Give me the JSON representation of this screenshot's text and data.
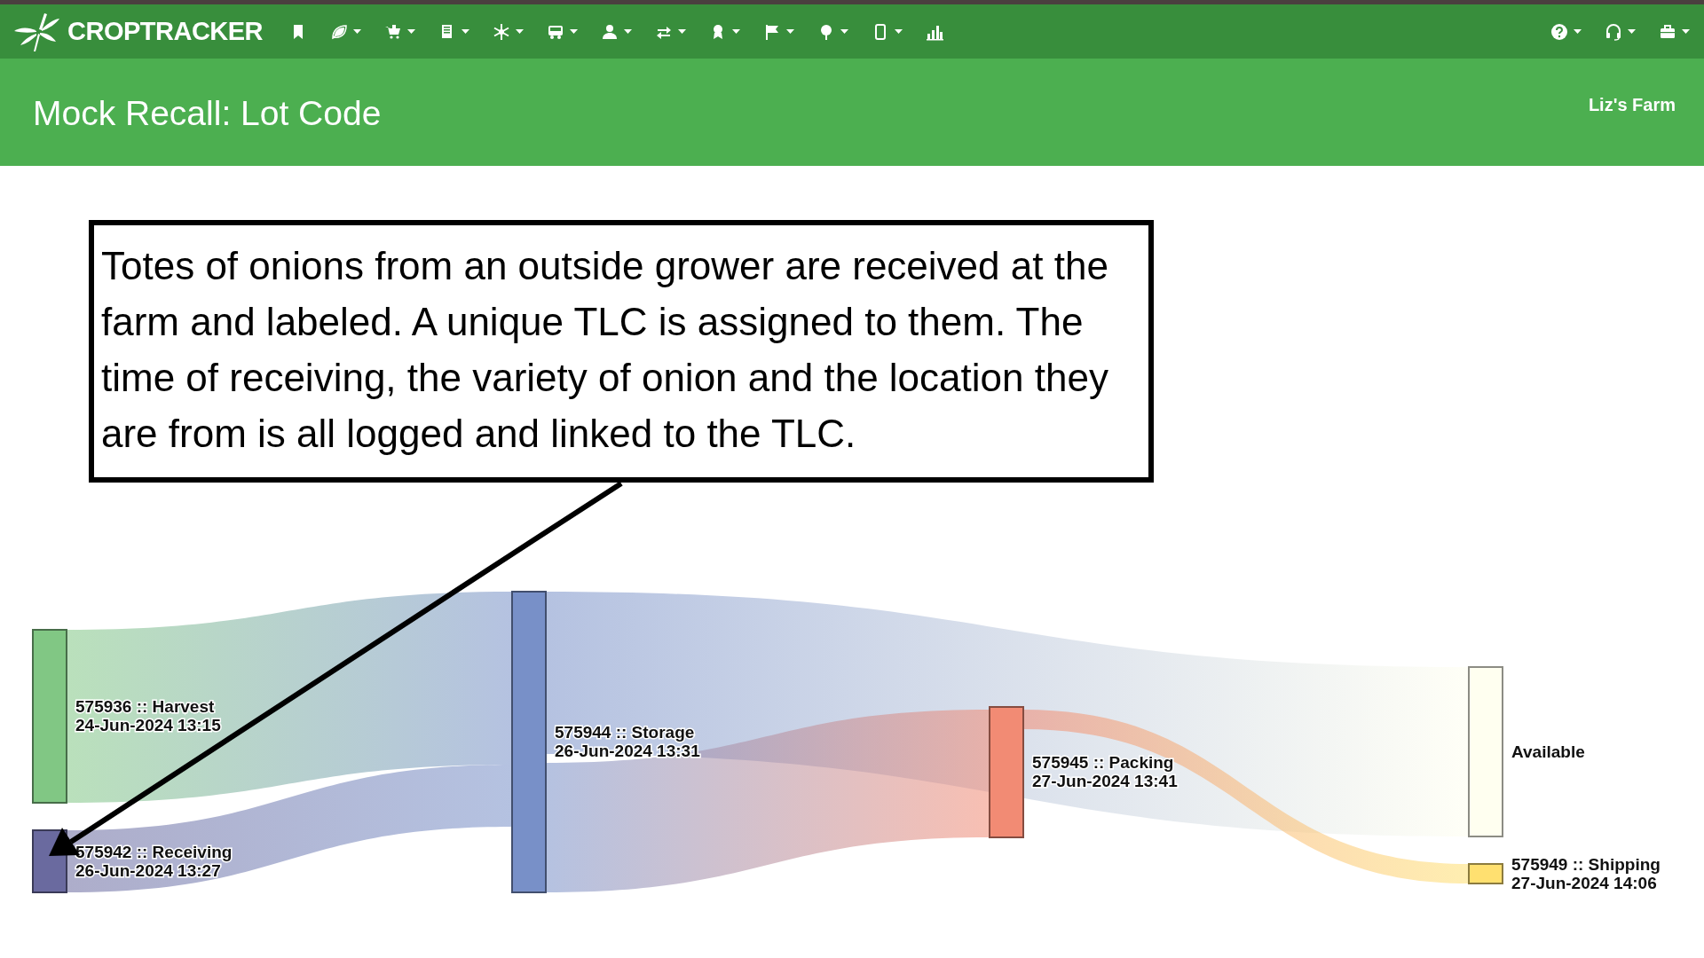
{
  "app_bar": {
    "brand": "CROPTRACKER"
  },
  "header": {
    "title": "Mock Recall: Lot Code",
    "farm": "Liz's Farm"
  },
  "callout": {
    "text": "Totes of onions from an outside grower are received at the farm and labeled. A unique TLC is assigned to them. The time of receiving, the variety of onion and the location they are from is all logged and linked to the TLC."
  },
  "sankey": {
    "nodes": [
      {
        "lines": [
          "575936 :: Harvest",
          "24-Jun-2024 13:15"
        ],
        "color": "#81c784"
      },
      {
        "lines": [
          "575942 :: Receiving",
          "26-Jun-2024 13:27"
        ],
        "color": "#6a6a9f"
      },
      {
        "lines": [
          "575944 :: Storage",
          "26-Jun-2024 13:31"
        ],
        "color": "#7890c8"
      },
      {
        "lines": [
          "575945 :: Packing",
          "27-Jun-2024 13:41"
        ],
        "color": "#f28b74"
      },
      {
        "lines": [
          "Available"
        ],
        "color": "#fffff0"
      },
      {
        "lines": [
          "575949 :: Shipping",
          "27-Jun-2024 14:06"
        ],
        "color": "#ffe070"
      }
    ]
  }
}
